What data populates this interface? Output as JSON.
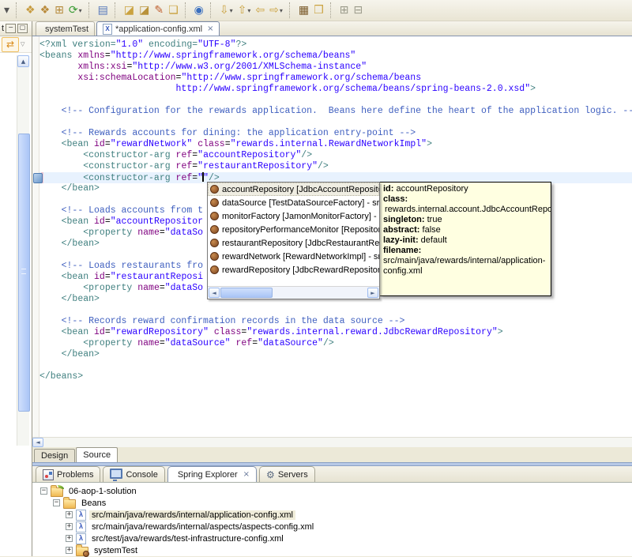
{
  "colors": {
    "chrome_bg": "#ece9d8",
    "editor_bg": "#ffffff",
    "tag": "#3f7f7f",
    "attr": "#7f007f",
    "val": "#2a00ff",
    "comment": "#3f5fbf",
    "current_line": "#e8f2fe",
    "tooltip_bg": "#ffffe1",
    "accent_blue": "#b7c9e6",
    "selection_cream": "#f0edda"
  },
  "icons": {
    "spring-leaf": "shape:leaf",
    "xml-file": "X",
    "close": "×",
    "bean": "shape:bean",
    "problems": "shape:problems",
    "console": "shape:console",
    "servers": "⚙",
    "spring-project": "shape:folder-leaf",
    "beans-folder": "shape:folder",
    "spring-config-file": "λ",
    "config-set": "shape:folder-bean",
    "up-arrow": "▲",
    "left-arrow": "◄",
    "right-arrow": "►",
    "sync": "⇄",
    "dropdown-small": "▽",
    "minimize": "−",
    "maximize": "▢",
    "caret": "▾"
  },
  "toolbar": {
    "groups": [
      [
        {
          "name": "overflow-dropdown-button",
          "glyph": "▾",
          "color": "#555555",
          "caret": false
        }
      ],
      [
        {
          "name": "new-spring-project-button",
          "glyph": "❖",
          "color": "#c79b3f",
          "caret": false
        },
        {
          "name": "new-spring-bean-config-button",
          "glyph": "❖",
          "color": "#b98a3a",
          "caret": false
        },
        {
          "name": "new-bean-button",
          "glyph": "⊞",
          "color": "#b5893a",
          "caret": false
        },
        {
          "name": "refresh-button",
          "glyph": "⟳",
          "color": "#3a9b35",
          "caret": true
        }
      ],
      [
        {
          "name": "show-view-button",
          "glyph": "▤",
          "color": "#5577bb",
          "caret": false
        }
      ],
      [
        {
          "name": "open-file-button",
          "glyph": "◪",
          "color": "#caa23f",
          "caret": false
        },
        {
          "name": "open-resource-button",
          "glyph": "◪",
          "color": "#b9923a",
          "caret": false
        },
        {
          "name": "mark-occurrences-button",
          "glyph": "✎",
          "color": "#c06030",
          "caret": false
        },
        {
          "name": "open-folder-button",
          "glyph": "❏",
          "color": "#caa23f",
          "caret": false
        }
      ],
      [
        {
          "name": "web-browser-button",
          "glyph": "◉",
          "color": "#3a6fbf",
          "caret": false
        }
      ],
      [
        {
          "name": "last-edit-location-button",
          "glyph": "⇩",
          "color": "#caa23f",
          "caret": true
        },
        {
          "name": "go-to-type-button",
          "glyph": "⇧",
          "color": "#caa23f",
          "caret": true
        },
        {
          "name": "back-button",
          "glyph": "⇦",
          "color": "#caa23f",
          "caret": false
        },
        {
          "name": "forward-button",
          "glyph": "⇨",
          "color": "#caa23f",
          "caret": true
        }
      ],
      [
        {
          "name": "run-history-button",
          "glyph": "▦",
          "color": "#7a5a2a",
          "caret": false
        },
        {
          "name": "external-tools-button",
          "glyph": "❒",
          "color": "#caa23f",
          "caret": false
        }
      ],
      [
        {
          "name": "expand-all-button",
          "glyph": "⊞",
          "color": "#9a9a8a",
          "caret": false
        },
        {
          "name": "collapse-all-button",
          "glyph": "⊟",
          "color": "#9a9a8a",
          "caret": false
        }
      ]
    ]
  },
  "left_panel": {
    "tab_tail": "t"
  },
  "editor": {
    "tabs": [
      {
        "label": "systemTest",
        "icon": "spring-leaf",
        "active": false,
        "closable": false
      },
      {
        "label": "*application-config.xml",
        "icon": "xml-file",
        "active": true,
        "closable": true
      }
    ],
    "bottom_tabs": [
      {
        "label": "Design",
        "active": false
      },
      {
        "label": "Source",
        "active": true
      }
    ],
    "code_lines": [
      {
        "s": [
          [
            "tag",
            "<?xml version="
          ],
          [
            "val",
            "\"1.0\""
          ],
          [
            "tag",
            " encoding="
          ],
          [
            "val",
            "\"UTF-8\""
          ],
          [
            "tag",
            "?>"
          ]
        ]
      },
      {
        "s": [
          [
            "tag",
            "<beans "
          ],
          [
            "attr",
            "xmlns"
          ],
          [
            "eq",
            "="
          ],
          [
            "val",
            "\"http://www.springframework.org/schema/beans\""
          ]
        ]
      },
      {
        "s": [
          [
            "pl",
            "       "
          ],
          [
            "attr",
            "xmlns:xsi"
          ],
          [
            "eq",
            "="
          ],
          [
            "val",
            "\"http://www.w3.org/2001/XMLSchema-instance\""
          ]
        ]
      },
      {
        "s": [
          [
            "pl",
            "       "
          ],
          [
            "attr",
            "xsi:schemaLocation"
          ],
          [
            "eq",
            "="
          ],
          [
            "val",
            "\"http://www.springframework.org/schema/beans"
          ]
        ]
      },
      {
        "s": [
          [
            "val",
            "                         http://www.springframework.org/schema/beans/spring-beans-2.0.xsd\""
          ],
          [
            "tag",
            ">"
          ]
        ]
      },
      {
        "s": []
      },
      {
        "s": [
          [
            "pl",
            "    "
          ],
          [
            "com",
            "<!-- Configuration for the rewards application.  Beans here define the heart of the application logic. -->"
          ]
        ]
      },
      {
        "s": []
      },
      {
        "s": [
          [
            "pl",
            "    "
          ],
          [
            "com",
            "<!-- Rewards accounts for dining: the application entry-point -->"
          ]
        ]
      },
      {
        "s": [
          [
            "pl",
            "    "
          ],
          [
            "tag",
            "<bean "
          ],
          [
            "attr",
            "id"
          ],
          [
            "eq",
            "="
          ],
          [
            "val",
            "\"rewardNetwork\""
          ],
          [
            "pl",
            " "
          ],
          [
            "attr",
            "class"
          ],
          [
            "eq",
            "="
          ],
          [
            "val",
            "\"rewards.internal.RewardNetworkImpl\""
          ],
          [
            "tag",
            ">"
          ]
        ]
      },
      {
        "s": [
          [
            "pl",
            "        "
          ],
          [
            "tag",
            "<constructor-arg "
          ],
          [
            "attr",
            "ref"
          ],
          [
            "eq",
            "="
          ],
          [
            "val",
            "\"accountRepository\""
          ],
          [
            "tag",
            "/>"
          ]
        ]
      },
      {
        "s": [
          [
            "pl",
            "        "
          ],
          [
            "tag",
            "<constructor-arg "
          ],
          [
            "attr",
            "ref"
          ],
          [
            "eq",
            "="
          ],
          [
            "val",
            "\"restaurantRepository\""
          ],
          [
            "tag",
            "/>"
          ]
        ]
      },
      {
        "current": true,
        "s": [
          [
            "pl",
            "        "
          ],
          [
            "tag",
            "<constructor-arg "
          ],
          [
            "attr",
            "ref"
          ],
          [
            "eq",
            "="
          ],
          [
            "val",
            "\""
          ],
          [
            "cursor",
            ""
          ],
          [
            "val",
            "\""
          ],
          [
            "tag",
            "/>"
          ]
        ]
      },
      {
        "s": [
          [
            "pl",
            "    "
          ],
          [
            "tag",
            "</bean>"
          ]
        ]
      },
      {
        "s": []
      },
      {
        "s": [
          [
            "pl",
            "    "
          ],
          [
            "com",
            "<!-- Loads accounts from t"
          ]
        ]
      },
      {
        "s": [
          [
            "pl",
            "    "
          ],
          [
            "tag",
            "<bean "
          ],
          [
            "attr",
            "id"
          ],
          [
            "eq",
            "="
          ],
          [
            "val",
            "\"accountRepositor"
          ]
        ]
      },
      {
        "s": [
          [
            "pl",
            "        "
          ],
          [
            "tag",
            "<property "
          ],
          [
            "attr",
            "name"
          ],
          [
            "eq",
            "="
          ],
          [
            "val",
            "\"dataSo"
          ]
        ]
      },
      {
        "s": [
          [
            "pl",
            "    "
          ],
          [
            "tag",
            "</bean>"
          ]
        ]
      },
      {
        "s": []
      },
      {
        "s": [
          [
            "pl",
            "    "
          ],
          [
            "com",
            "<!-- Loads restaurants fro"
          ]
        ]
      },
      {
        "s": [
          [
            "pl",
            "    "
          ],
          [
            "tag",
            "<bean "
          ],
          [
            "attr",
            "id"
          ],
          [
            "eq",
            "="
          ],
          [
            "val",
            "\"restaurantReposi"
          ]
        ]
      },
      {
        "s": [
          [
            "pl",
            "        "
          ],
          [
            "tag",
            "<property "
          ],
          [
            "attr",
            "name"
          ],
          [
            "eq",
            "="
          ],
          [
            "val",
            "\"dataSo"
          ]
        ]
      },
      {
        "s": [
          [
            "pl",
            "    "
          ],
          [
            "tag",
            "</bean>"
          ]
        ]
      },
      {
        "s": []
      },
      {
        "s": [
          [
            "pl",
            "    "
          ],
          [
            "com",
            "<!-- Records reward confirmation records in the data source -->"
          ]
        ]
      },
      {
        "s": [
          [
            "pl",
            "    "
          ],
          [
            "tag",
            "<bean "
          ],
          [
            "attr",
            "id"
          ],
          [
            "eq",
            "="
          ],
          [
            "val",
            "\"rewardRepository\""
          ],
          [
            "pl",
            " "
          ],
          [
            "attr",
            "class"
          ],
          [
            "eq",
            "="
          ],
          [
            "val",
            "\"rewards.internal.reward.JdbcRewardRepository\""
          ],
          [
            "tag",
            ">"
          ]
        ]
      },
      {
        "s": [
          [
            "pl",
            "        "
          ],
          [
            "tag",
            "<property "
          ],
          [
            "attr",
            "name"
          ],
          [
            "eq",
            "="
          ],
          [
            "val",
            "\"dataSource\""
          ],
          [
            "pl",
            " "
          ],
          [
            "attr",
            "ref"
          ],
          [
            "eq",
            "="
          ],
          [
            "val",
            "\"dataSource\""
          ],
          [
            "tag",
            "/>"
          ]
        ]
      },
      {
        "s": [
          [
            "pl",
            "    "
          ],
          [
            "tag",
            "</bean>"
          ]
        ]
      },
      {
        "s": []
      },
      {
        "s": [
          [
            "tag",
            "</beans>"
          ]
        ]
      }
    ]
  },
  "popup": {
    "items": [
      {
        "label": "accountRepository [JdbcAccountRepository] - src/",
        "selected": true
      },
      {
        "label": "dataSource [TestDataSourceFactory] - src/test/ja",
        "selected": false
      },
      {
        "label": "monitorFactory [JamonMonitorFactory] - src/main",
        "selected": false
      },
      {
        "label": "repositoryPerformanceMonitor [RepositoryPerfor",
        "selected": false
      },
      {
        "label": "restaurantRepository [JdbcRestaurantRepository]",
        "selected": false
      },
      {
        "label": "rewardNetwork [RewardNetworkImpl] - src/main/j",
        "selected": false
      },
      {
        "label": "rewardRepository [JdbcRewardRepository] - src/r",
        "selected": false
      }
    ]
  },
  "tooltip": {
    "rows": [
      {
        "label": "id:",
        "value": "accountRepository",
        "block": false
      },
      {
        "label": "class:",
        "value": "rewards.internal.account.JdbcAccountRepository",
        "block": true
      },
      {
        "label": "singleton:",
        "value": "true",
        "block": false
      },
      {
        "label": "abstract:",
        "value": "false",
        "block": false
      },
      {
        "label": "lazy-init:",
        "value": "default",
        "block": false
      },
      {
        "label": "filename:",
        "value": "src/main/java/rewards/internal/application-config.xml",
        "block": false
      }
    ]
  },
  "bottom_panel": {
    "tabs": [
      {
        "label": "Problems",
        "icon": "problems",
        "active": false,
        "closable": false
      },
      {
        "label": "Console",
        "icon": "console",
        "active": false,
        "closable": false
      },
      {
        "label": "Spring Explorer",
        "icon": "spring-leaf",
        "active": true,
        "closable": true
      },
      {
        "label": "Servers",
        "icon": "servers",
        "active": false,
        "closable": false
      }
    ],
    "tree": [
      {
        "label": "06-aop-1-solution",
        "icon": "spring-project",
        "expander": "−",
        "indent": 0,
        "selected": false
      },
      {
        "label": "Beans",
        "icon": "beans-folder",
        "expander": "−",
        "indent": 1,
        "selected": false
      },
      {
        "label": "src/main/java/rewards/internal/application-config.xml",
        "icon": "spring-config-file",
        "expander": "+",
        "indent": 2,
        "selected": true
      },
      {
        "label": "src/main/java/rewards/internal/aspects/aspects-config.xml",
        "icon": "spring-config-file",
        "expander": "+",
        "indent": 2,
        "selected": false
      },
      {
        "label": "src/test/java/rewards/test-infrastructure-config.xml",
        "icon": "spring-config-file",
        "expander": "+",
        "indent": 2,
        "selected": false
      },
      {
        "label": "systemTest",
        "icon": "config-set",
        "expander": "+",
        "indent": 2,
        "selected": false
      }
    ]
  }
}
